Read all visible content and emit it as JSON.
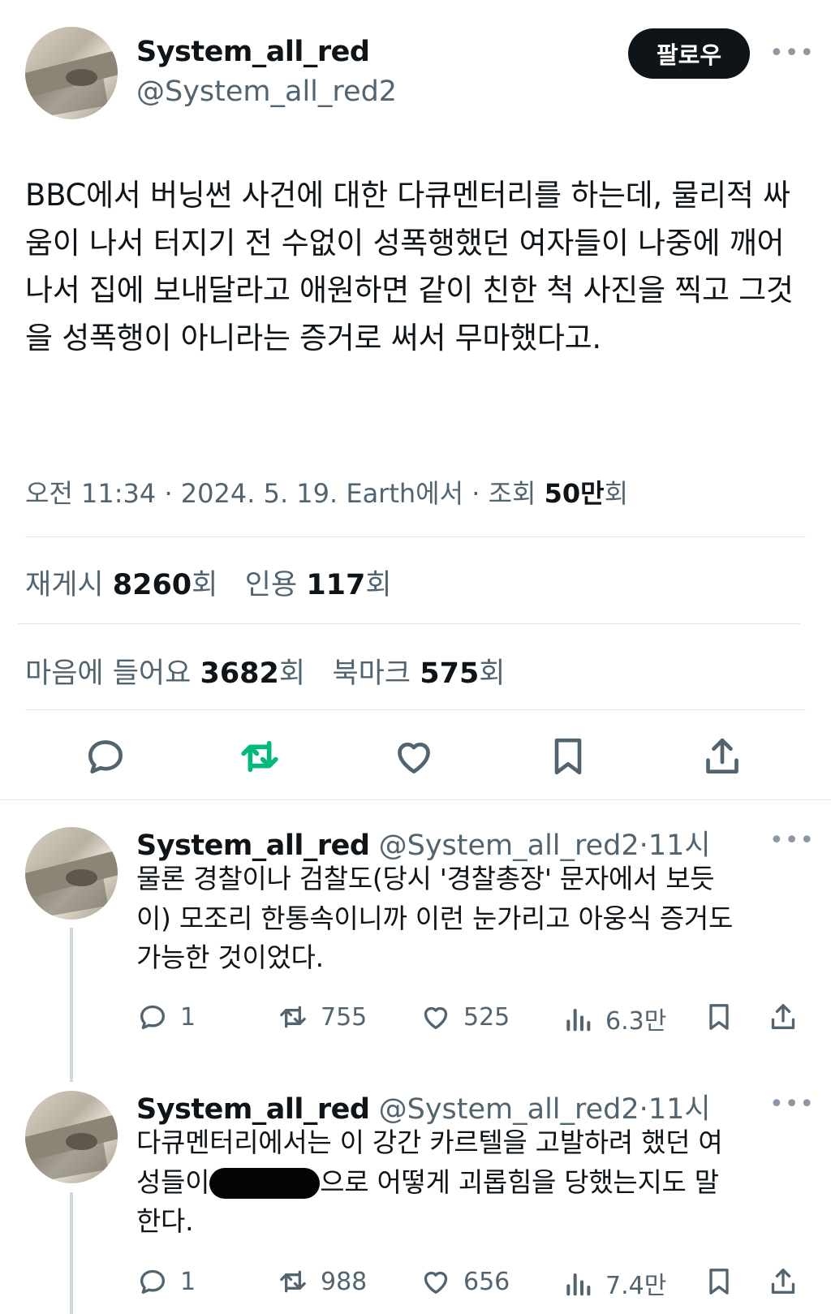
{
  "main_tweet": {
    "author_name": "System_all_red",
    "author_handle": "@System_all_red2",
    "follow_label": "팔로우",
    "more_label": "•••",
    "text": "BBC에서 버닝썬 사건에 대한 다큐멘터리를 하는데, 물리적 싸움이 나서 터지기 전 수없이 성폭행했던 여자들이 나중에 깨어나서 집에 보내달라고 애원하면 같이 친한 척 사진을 찍고 그것을 성폭행이 아니라는 증거로 써서 무마했다고.",
    "time": "오전 11:34",
    "date": "2024. 5. 19.",
    "source": "Earth에서",
    "views_label": "조회",
    "views_value": "50만",
    "views_unit": "회",
    "sep": "·",
    "reposts_label": "재게시",
    "reposts_value": "8260",
    "reposts_unit": "회",
    "quotes_label": "인용",
    "quotes_value": "117",
    "quotes_unit": "회",
    "likes_label": "마음에 들어요",
    "likes_value": "3682",
    "likes_unit": "회",
    "bookmarks_label": "북마크",
    "bookmarks_value": "575",
    "bookmarks_unit": "회",
    "actions": [
      "reply-icon",
      "repost-icon",
      "like-icon",
      "bookmark-icon",
      "share-icon"
    ],
    "repost_active_color": "#00ba7c"
  },
  "replies": [
    {
      "author_name": "System_all_red",
      "author_handle": "@System_all_red2",
      "time": "11시",
      "sep": "·",
      "more_label": "•••",
      "text_lines": [
        "물론 경찰이나 검찰도(당시 '경찰총장' 문자에서 보듯",
        "이) 모조리 한통속이니까 이런 눈가리고 아웅식 증거도",
        "가능한 것이었다."
      ],
      "reply_count": "1",
      "repost_count": "755",
      "like_count": "525",
      "view_count": "6.3만"
    },
    {
      "author_name": "System_all_red",
      "author_handle": "@System_all_red2",
      "time": "11시",
      "sep": "·",
      "more_label": "•••",
      "text_line1": "다큐멘터리에서는 이 강간 카르텔을 고발하려 했던 여",
      "text_line2_pre": "성들이",
      "text_line2_post": "으로 어떻게 괴롭힘을 당했는지도 말",
      "text_line3": "한다.",
      "reply_count": "1",
      "repost_count": "988",
      "like_count": "656",
      "view_count": "7.4만"
    }
  ],
  "colors": {
    "text": "#0f1419",
    "secondary": "#536471",
    "divider": "#e1e5e8",
    "repost_green": "#00ba7c"
  }
}
